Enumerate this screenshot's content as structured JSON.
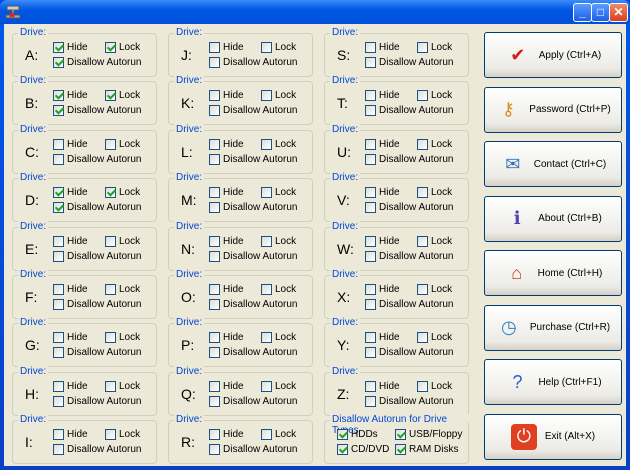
{
  "window": {
    "minimize": "_",
    "maximize": "□",
    "close": "✕"
  },
  "drive_group_label": "Drive:",
  "labels": {
    "hide": "Hide",
    "lock": "Lock",
    "autorun": "Disallow Autorun"
  },
  "drives": [
    {
      "letter": "A:",
      "hide": true,
      "lock": true,
      "autorun": true
    },
    {
      "letter": "B:",
      "hide": true,
      "lock": true,
      "autorun": true
    },
    {
      "letter": "C:",
      "hide": false,
      "lock": false,
      "autorun": false
    },
    {
      "letter": "D:",
      "hide": true,
      "lock": true,
      "autorun": true
    },
    {
      "letter": "E:",
      "hide": false,
      "lock": false,
      "autorun": false
    },
    {
      "letter": "F:",
      "hide": false,
      "lock": false,
      "autorun": false
    },
    {
      "letter": "G:",
      "hide": false,
      "lock": false,
      "autorun": false
    },
    {
      "letter": "H:",
      "hide": false,
      "lock": false,
      "autorun": false
    },
    {
      "letter": "I:",
      "hide": false,
      "lock": false,
      "autorun": false
    },
    {
      "letter": "J:",
      "hide": false,
      "lock": false,
      "autorun": false
    },
    {
      "letter": "K:",
      "hide": false,
      "lock": false,
      "autorun": false
    },
    {
      "letter": "L:",
      "hide": false,
      "lock": false,
      "autorun": false
    },
    {
      "letter": "M:",
      "hide": false,
      "lock": false,
      "autorun": false
    },
    {
      "letter": "N:",
      "hide": false,
      "lock": false,
      "autorun": false
    },
    {
      "letter": "O:",
      "hide": false,
      "lock": false,
      "autorun": false
    },
    {
      "letter": "P:",
      "hide": false,
      "lock": false,
      "autorun": false
    },
    {
      "letter": "Q:",
      "hide": false,
      "lock": false,
      "autorun": false
    },
    {
      "letter": "R:",
      "hide": false,
      "lock": false,
      "autorun": false
    },
    {
      "letter": "S:",
      "hide": false,
      "lock": false,
      "autorun": false
    },
    {
      "letter": "T:",
      "hide": false,
      "lock": false,
      "autorun": false
    },
    {
      "letter": "U:",
      "hide": false,
      "lock": false,
      "autorun": false
    },
    {
      "letter": "V:",
      "hide": false,
      "lock": false,
      "autorun": false
    },
    {
      "letter": "W:",
      "hide": false,
      "lock": false,
      "autorun": false
    },
    {
      "letter": "X:",
      "hide": false,
      "lock": false,
      "autorun": false
    },
    {
      "letter": "Y:",
      "hide": false,
      "lock": false,
      "autorun": false
    },
    {
      "letter": "Z:",
      "hide": false,
      "lock": false,
      "autorun": false
    }
  ],
  "autorun_types": {
    "title": "Disallow Autorun for Drive Types",
    "items": [
      {
        "label": "HDDs",
        "checked": true
      },
      {
        "label": "USB/Floppy",
        "checked": true
      },
      {
        "label": "CD/DVD",
        "checked": true
      },
      {
        "label": "RAM Disks",
        "checked": true
      }
    ]
  },
  "buttons": [
    {
      "label": "Apply (Ctrl+A)",
      "icon": "clipboard-check-icon",
      "glyph": "✔",
      "color": "#d02020"
    },
    {
      "label": "Password (Ctrl+P)",
      "icon": "keys-icon",
      "glyph": "⚷",
      "color": "#d89020"
    },
    {
      "label": "Contact (Ctrl+C)",
      "icon": "envelope-icon",
      "glyph": "✉",
      "color": "#3070c0"
    },
    {
      "label": "About (Ctrl+B)",
      "icon": "info-book-icon",
      "glyph": "ℹ",
      "color": "#5040b0"
    },
    {
      "label": "Home (Ctrl+H)",
      "icon": "home-icon",
      "glyph": "⌂",
      "color": "#c04020"
    },
    {
      "label": "Purchase (Ctrl+R)",
      "icon": "stopwatch-icon",
      "glyph": "◷",
      "color": "#3080c0"
    },
    {
      "label": "Help (Ctrl+F1)",
      "icon": "help-icon",
      "glyph": "?",
      "color": "#2060d0"
    },
    {
      "label": "Exit (Alt+X)",
      "icon": "power-icon",
      "glyph": "⏻",
      "color": "#e04020"
    }
  ]
}
